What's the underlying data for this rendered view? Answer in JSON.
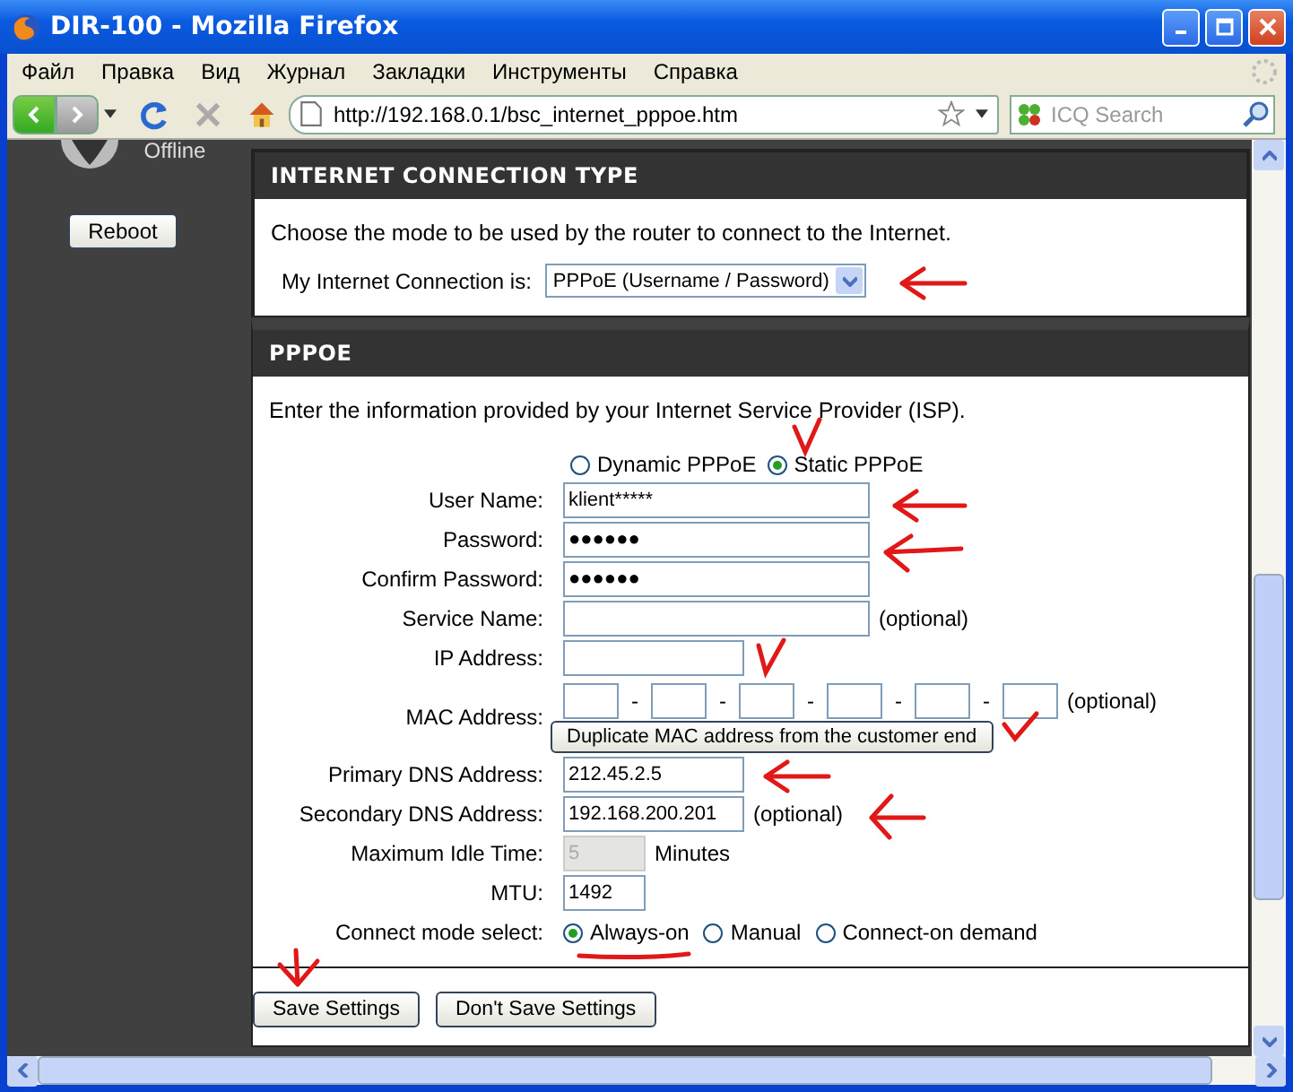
{
  "window": {
    "title": "DIR-100 - Mozilla Firefox"
  },
  "menu": [
    "Файл",
    "Правка",
    "Вид",
    "Журнал",
    "Закладки",
    "Инструменты",
    "Справка"
  ],
  "toolbar": {
    "url": "http://192.168.0.1/bsc_internet_pppoe.htm",
    "search": {
      "placeholder": "ICQ Search"
    }
  },
  "sidebar": {
    "status": "Offline",
    "reboot_button": "Reboot"
  },
  "connection_type": {
    "title": "INTERNET CONNECTION TYPE",
    "description": "Choose the mode to be used by the router to connect to the Internet.",
    "label": "My Internet Connection is:",
    "value": "PPPoE (Username / Password)"
  },
  "pppoe": {
    "title": "PPPOE",
    "description": "Enter the information provided by your Internet Service Provider (ISP).",
    "mode_options": [
      {
        "label": "Dynamic PPPoE",
        "selected": false
      },
      {
        "label": "Static PPPoE",
        "selected": true
      }
    ],
    "fields": [
      {
        "kind": "long",
        "label": "User Name:",
        "value": "klient*****",
        "disabled": false
      },
      {
        "kind": "long",
        "label": "Password:",
        "value": "●●●●●●",
        "disabled": false
      },
      {
        "kind": "long",
        "label": "Confirm Password:",
        "value": "●●●●●●",
        "disabled": false
      },
      {
        "kind": "long",
        "label": "Service Name:",
        "suffix": "(optional)",
        "disabled": false
      },
      {
        "kind": "short",
        "label": "IP Address:",
        "disabled": false
      },
      {
        "kind": "mac",
        "label": "MAC Address:",
        "separators": [
          "-",
          "-",
          "-",
          "-",
          "-"
        ],
        "suffix": "(optional)",
        "button": "Duplicate MAC address from the customer end"
      },
      {
        "kind": "short",
        "label": "Primary DNS Address:",
        "value": "212.45.2.5",
        "disabled": false
      },
      {
        "kind": "short",
        "label": "Secondary DNS Address:",
        "value": "192.168.200.201",
        "suffix": "(optional)",
        "disabled": false
      },
      {
        "kind": "tiny",
        "label": "Maximum Idle Time:",
        "value": "5",
        "suffix": "Minutes",
        "disabled": true
      },
      {
        "kind": "tiny",
        "label": "MTU:",
        "value": "1492",
        "disabled": false
      },
      {
        "kind": "radio",
        "label": "Connect mode select:",
        "options": [
          {
            "label": "Always-on",
            "selected": true
          },
          {
            "label": "Manual",
            "selected": false
          },
          {
            "label": "Connect-on demand",
            "selected": false
          }
        ]
      }
    ]
  },
  "buttons": [
    "Save Settings",
    "Don't Save Settings"
  ]
}
